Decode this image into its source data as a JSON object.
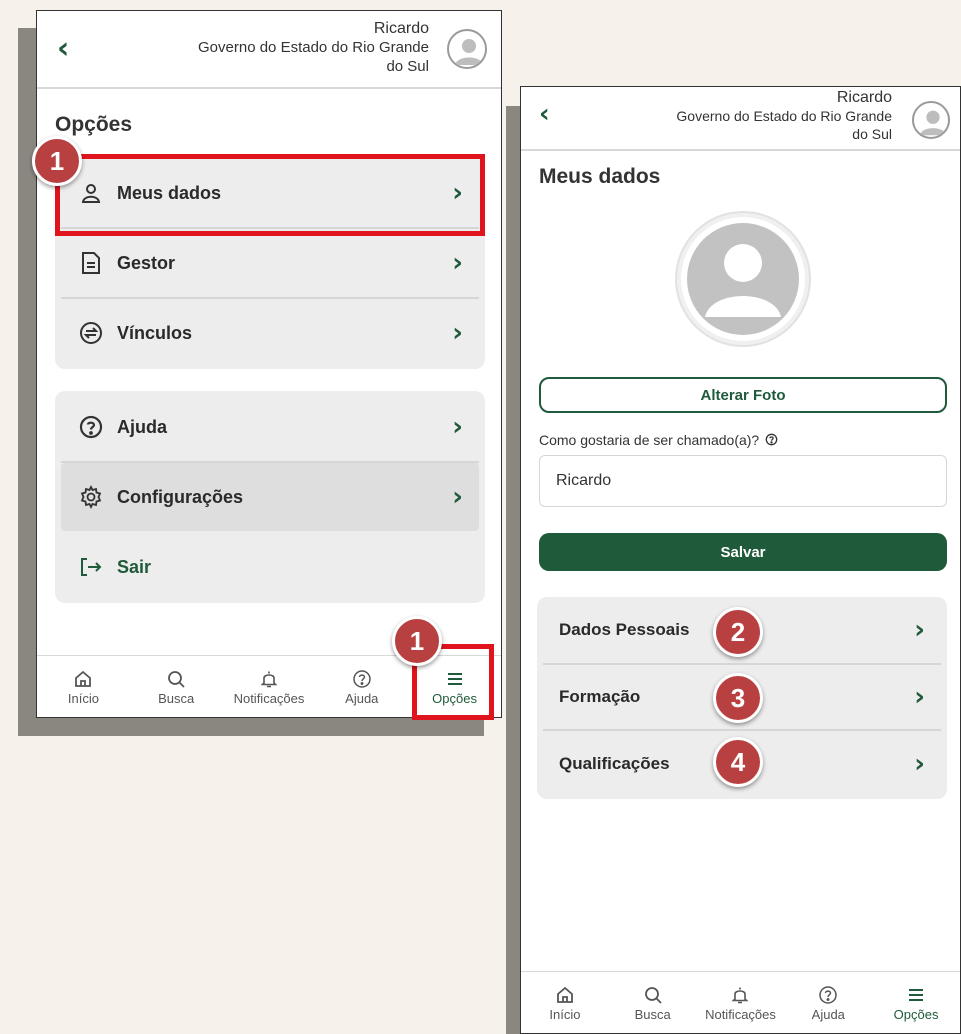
{
  "colors": {
    "accent": "#1f5a3a",
    "highlight": "#e0141c",
    "badge": "#b94040"
  },
  "header": {
    "name": "Ricardo",
    "org_line1": "Governo do Estado do Rio Grande",
    "org_line2": "do Sul"
  },
  "left": {
    "title": "Opções",
    "group1": [
      {
        "label": "Meus dados",
        "icon": "person-icon"
      },
      {
        "label": "Gestor",
        "icon": "document-icon"
      },
      {
        "label": "Vínculos",
        "icon": "swap-icon"
      }
    ],
    "group2": [
      {
        "label": "Ajuda",
        "icon": "help-icon"
      },
      {
        "label": "Configurações",
        "icon": "gear-icon"
      },
      {
        "label": "Sair",
        "icon": "logout-icon"
      }
    ],
    "badges": [
      "1",
      "1"
    ]
  },
  "tabs": [
    {
      "label": "Início",
      "icon": "home-icon"
    },
    {
      "label": "Busca",
      "icon": "search-icon"
    },
    {
      "label": "Notificações",
      "icon": "bell-icon"
    },
    {
      "label": "Ajuda",
      "icon": "help-icon"
    },
    {
      "label": "Opções",
      "icon": "menu-icon"
    }
  ],
  "right": {
    "title": "Meus dados",
    "change_photo": "Alterar Foto",
    "question": "Como gostaria de ser chamado(a)?",
    "nickname_value": "Ricardo",
    "save": "Salvar",
    "sections": [
      {
        "label": "Dados Pessoais",
        "badge": "2"
      },
      {
        "label": "Formação",
        "badge": "3"
      },
      {
        "label": "Qualificações",
        "badge": "4"
      }
    ]
  }
}
